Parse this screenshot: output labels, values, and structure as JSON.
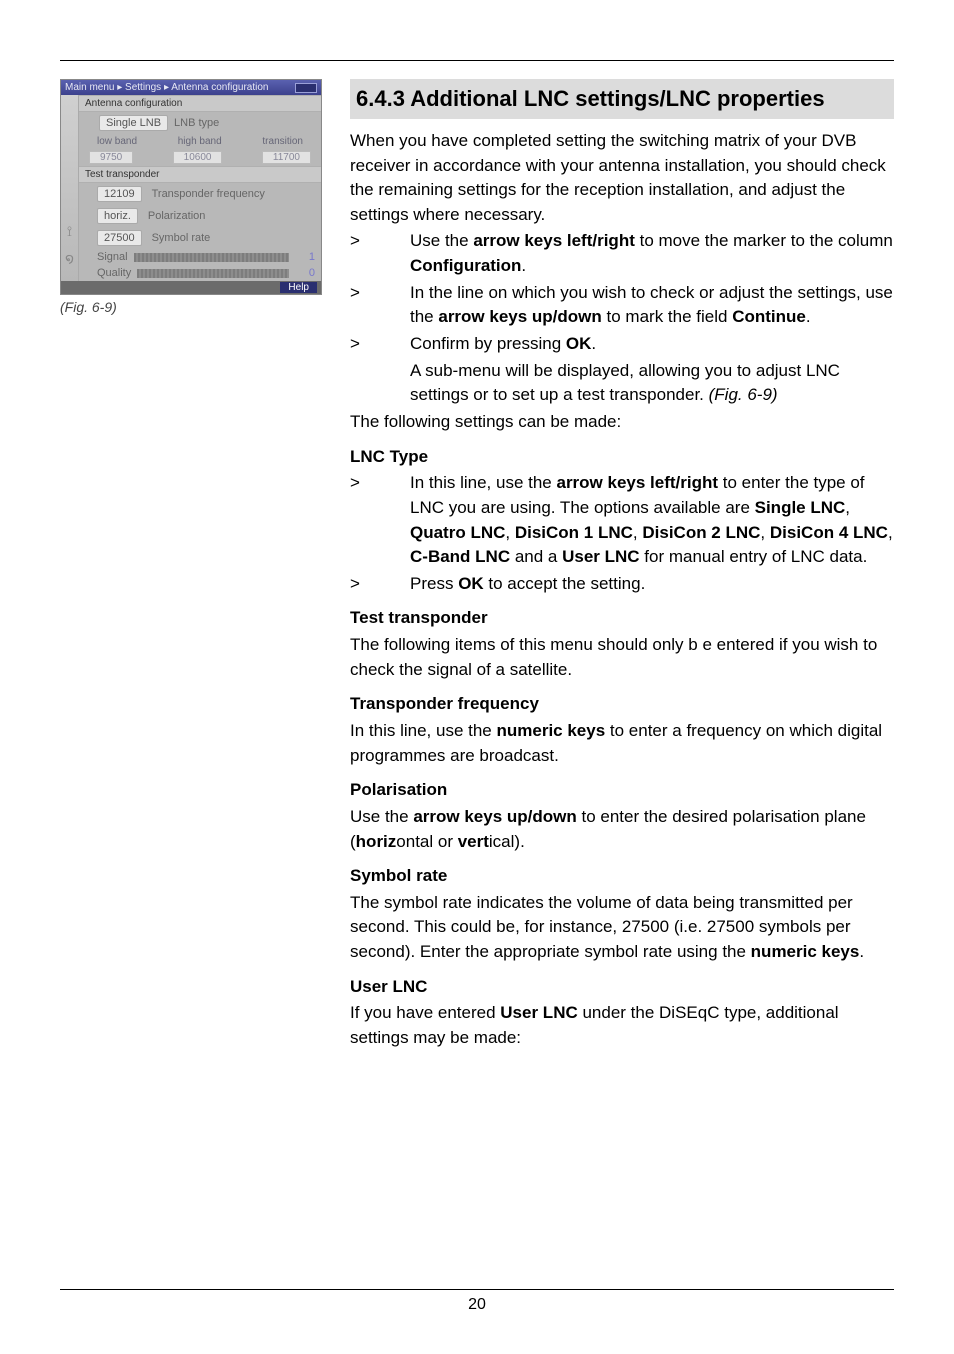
{
  "device": {
    "breadcrumb": "Main menu ▸ Settings ▸ Antenna configuration",
    "section_antenna": "Antenna configuration",
    "lnb_value": "Single LNB",
    "lnb_label": "LNB type",
    "band_low": "low band",
    "band_high": "high band",
    "band_trans": "transition",
    "val_low": "9750",
    "val_high": "10600",
    "val_trans": "11700",
    "section_test": "Test transponder",
    "tp_freq_val": "12109",
    "tp_freq_label": "Transponder frequency",
    "pol_val": "horiz.",
    "pol_label": "Polarization",
    "sym_val": "27500",
    "sym_label": "Symbol rate",
    "signal_label": "Signal",
    "signal_num": "1",
    "quality_label": "Quality",
    "quality_num": "0",
    "help": "Help"
  },
  "fig_caption": "(Fig. 6-9)",
  "heading": "6.4.3 Additional LNC settings/LNC properties",
  "intro": "When you have completed setting the switching matrix of your DVB receiver in accordance with your antenna installation, you should check the remaining settings for the reception installation, and adjust the settings where necessary.",
  "gt": ">",
  "step1_a": "Use the ",
  "step1_b": "arrow keys left/right",
  "step1_c": " to move the marker to the column ",
  "step1_d": "Configuration",
  "step1_e": ".",
  "step2_a": "In the line on which you wish to check or adjust the settings, use the ",
  "step2_b": "arrow keys up/down",
  "step2_c": " to mark the field ",
  "step2_d": "Continue",
  "step2_e": ".",
  "step3_a": "Confirm by pressing ",
  "step3_b": "OK",
  "step3_c": ".",
  "step3_sub_a": "A sub-menu will be displayed, allowing you to adjust LNC settings or to set up a test transponder. ",
  "step3_sub_b": "(Fig. 6-9)",
  "following": "The following settings can be made:",
  "lnc_type_h": "LNC Type",
  "lnc_1a": "In this line, use the ",
  "lnc_1b": "arrow keys left/right",
  "lnc_1c": " to enter the type of LNC you are using. The options available are ",
  "lnc_1d": "Single LNC",
  "lnc_1e": ", ",
  "lnc_1f": "Quatro LNC",
  "lnc_1g": ", ",
  "lnc_1h": "DisiCon 1 LNC",
  "lnc_1i": ", ",
  "lnc_1j": "DisiCon 2 LNC",
  "lnc_1k": ", ",
  "lnc_1l": "DisiCon 4 LNC",
  "lnc_1m": ", ",
  "lnc_1n": "C-Band LNC",
  "lnc_1o": " and a ",
  "lnc_1p": "User LNC",
  "lnc_1q": " for manual entry of LNC data.",
  "lnc_2a": "Press ",
  "lnc_2b": "OK",
  "lnc_2c": " to accept the setting.",
  "tt_h": "Test transponder",
  "tt_p": "The following items of this menu should only b e entered if you wish to check the signal of a satellite.",
  "tf_h": "Transponder frequency",
  "tf_a": "In this line, use the ",
  "tf_b": "numeric keys",
  "tf_c": " to enter a frequency on which digital programmes are broadcast.",
  "pol_h": "Polarisation",
  "pol_a": "Use the ",
  "pol_b": "arrow keys up/down",
  "pol_c": " to enter the desired polarisation plane (",
  "pol_d": "horiz",
  "pol_e": "ontal or ",
  "pol_f": "vert",
  "pol_g": "ical).",
  "sr_h": "Symbol rate",
  "sr_a": "The symbol rate indicates the volume of data being transmitted per second. This could be, for instance,  27500 (i.e. 27500 symbols per second). Enter the appropriate symbol rate using the ",
  "sr_b": "numeric keys",
  "sr_c": ".",
  "ul_h": "User LNC",
  "ul_a": "If you have entered ",
  "ul_b": "User LNC",
  "ul_c": " under the DiSEqC type, additional settings may be made:",
  "page_num": "20"
}
